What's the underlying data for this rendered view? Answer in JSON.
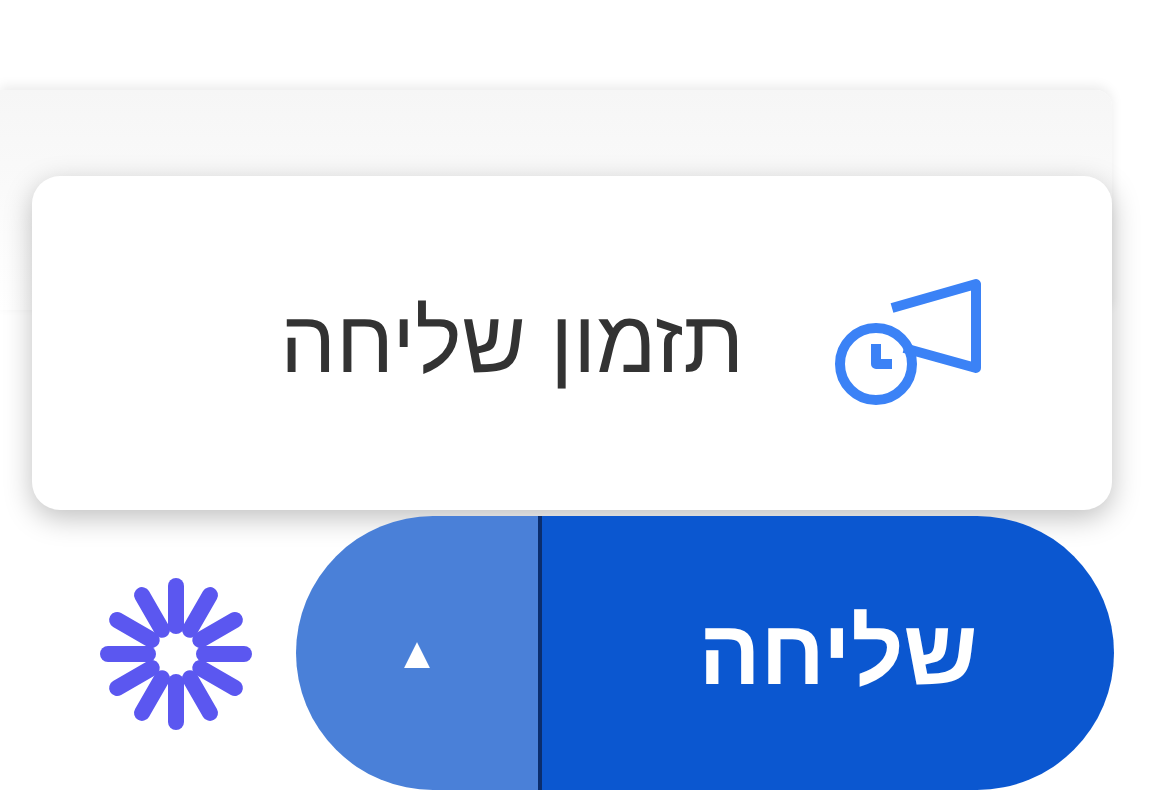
{
  "menu": {
    "items": [
      {
        "label": "תזמון שליחה"
      }
    ]
  },
  "send_button": {
    "label": "שליחה",
    "options_label": "▲"
  }
}
